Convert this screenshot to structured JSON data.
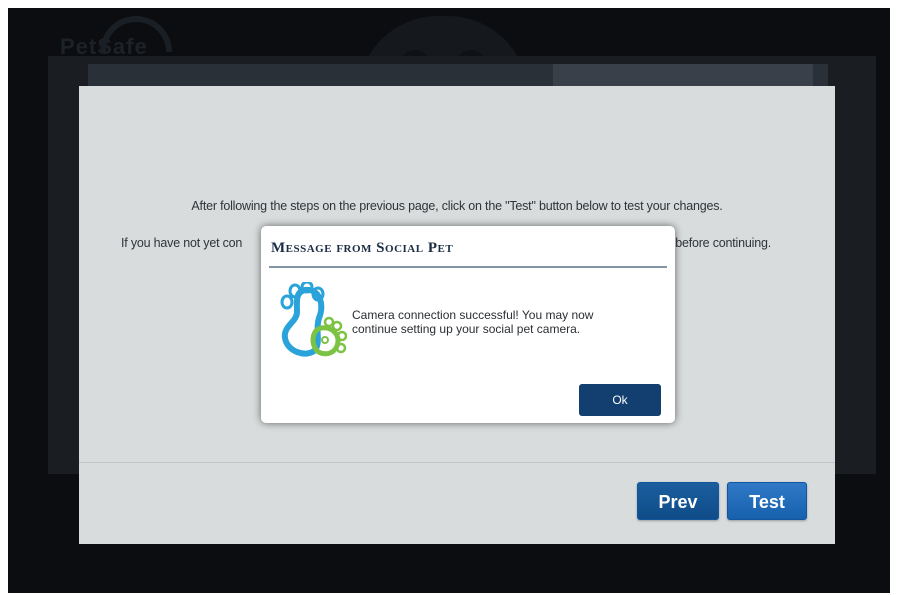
{
  "background": {
    "logo_text": "PetSafe"
  },
  "wizard": {
    "instruction": "After following the steps on the previous page, click on the \"Test\" button below to test your changes.",
    "notice_start": "If you have not yet con",
    "notice_end": "before continuing.",
    "prev_label": "Prev",
    "test_label": "Test",
    "button_color": "#1760ac"
  },
  "dialog": {
    "title": "Message from Social Pet",
    "message": "Camera connection successful! You may now continue setting up your social pet camera.",
    "ok_label": "Ok",
    "icon": "paw-logo-icon",
    "ok_color": "#123f6f"
  }
}
